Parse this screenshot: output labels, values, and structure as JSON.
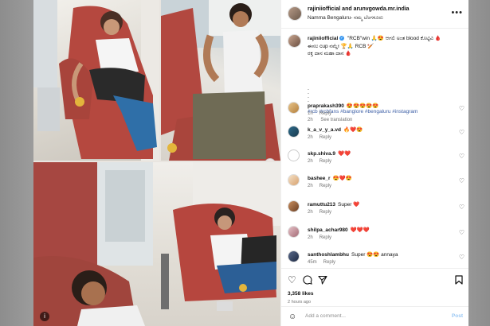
{
  "header": {
    "authors": "rajiniiofficial and arunvgowda.mr.india",
    "location": "Namma Bengaluru- ನಮ್ಮ ಬೆಂಗಳೂರು",
    "more_icon": "ellipsis-icon"
  },
  "caption": {
    "user": "rajiniiofficial",
    "text_line1": "\"RCB\"win 🙏😍 ಆಗಲಿ ಅಂತ blood ಕೊಟ್ಟಿವಿ 🩸",
    "text_line2": "ಈಸಲ cup ನಮ್ದೇ 🏆🙏 RCB 🏏",
    "text_line3": "ರಕ್ತ ದಾನ ಮಹಾ ದಾನ 🩸",
    "dots": ".\n.\n.\n.",
    "hashtags": "#rcb #rcbfans #banglore #bengaluru #instagram",
    "age": "2h",
    "translation": "See translation"
  },
  "comments": [
    {
      "user": "praprakash390",
      "text": "😍😍😍😍😍",
      "age": "1h",
      "reply": "Reply"
    },
    {
      "user": "k_a_v_y_a.vd",
      "text": "🔥❤️😍",
      "age": "2h",
      "reply": "Reply"
    },
    {
      "user": "skp.shiva.9",
      "text": "❤️❤️",
      "age": "2h",
      "reply": "Reply"
    },
    {
      "user": "bashee_r",
      "text": "😍❤️😍",
      "age": "2h",
      "reply": "Reply"
    },
    {
      "user": "ramuttu213",
      "text": "Super ❤️",
      "age": "2h",
      "reply": "Reply"
    },
    {
      "user": "shilpa_achar980",
      "text": "❤️❤️❤️",
      "age": "2h",
      "reply": "Reply"
    },
    {
      "user": "santhoshlambhu",
      "text": "Super 😍😍 annaya",
      "age": "45m",
      "reply": "Reply"
    }
  ],
  "actions": {
    "like_icon": "heart-icon",
    "comment_icon": "comment-icon",
    "share_icon": "share-icon",
    "save_icon": "bookmark-icon"
  },
  "likes": "3,358 likes",
  "posted": "2 hours ago",
  "add_comment": {
    "placeholder": "Add a comment...",
    "post_label": "Post"
  }
}
